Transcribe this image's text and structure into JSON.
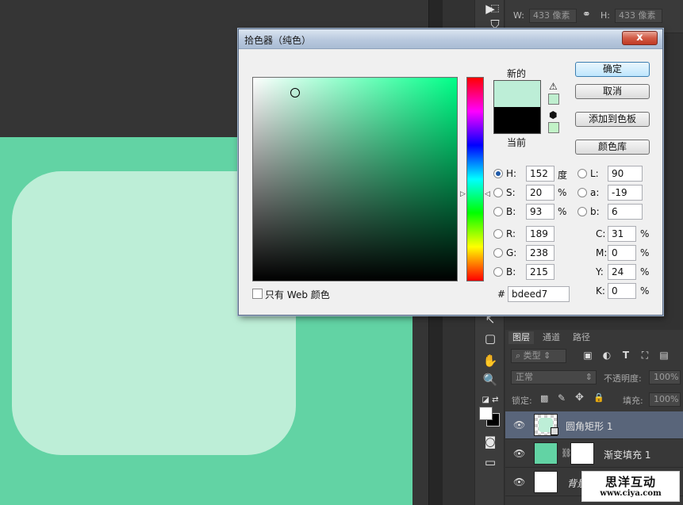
{
  "dialog": {
    "title": "拾色器（纯色）",
    "close_label": "x",
    "buttons": {
      "ok": "确定",
      "cancel": "取消",
      "add_swatch": "添加到色板",
      "libraries": "颜色库"
    },
    "new_label": "新的",
    "current_label": "当前",
    "web_only_label": "只有 Web 颜色",
    "hex_symbol": "#",
    "hex_value": "bdeed7",
    "colors": {
      "new": "#bdeed7",
      "current": "#000000",
      "hue_base": "#00ff88"
    },
    "hsb": {
      "h": {
        "label": "H:",
        "value": "152",
        "unit": "度"
      },
      "s": {
        "label": "S:",
        "value": "20",
        "unit": "%"
      },
      "b": {
        "label": "B:",
        "value": "93",
        "unit": "%"
      }
    },
    "lab": {
      "l": {
        "label": "L:",
        "value": "90"
      },
      "a": {
        "label": "a:",
        "value": "-19"
      },
      "b": {
        "label": "b:",
        "value": "6"
      }
    },
    "rgb": {
      "r": {
        "label": "R:",
        "value": "189"
      },
      "g": {
        "label": "G:",
        "value": "238"
      },
      "b": {
        "label": "B:",
        "value": "215"
      }
    },
    "cmyk": {
      "c": {
        "label": "C:",
        "value": "31",
        "unit": "%"
      },
      "m": {
        "label": "M:",
        "value": "0",
        "unit": "%"
      },
      "y": {
        "label": "Y:",
        "value": "24",
        "unit": "%"
      },
      "k": {
        "label": "K:",
        "value": "0",
        "unit": "%"
      }
    }
  },
  "properties": {
    "w_label": "W:",
    "w_value": "433 像素",
    "h_label": "H:",
    "h_value": "433 像素"
  },
  "layers_panel": {
    "tabs": [
      "图层",
      "通道",
      "路径"
    ],
    "filter_label": "类型",
    "blend_mode": "正常",
    "opacity_label": "不透明度:",
    "opacity_value": "100%",
    "lock_label": "锁定:",
    "fill_label": "填充:",
    "fill_value": "100%",
    "layers": [
      {
        "name": "圆角矩形 1"
      },
      {
        "name": "渐变填充 1"
      },
      {
        "name": "背景"
      }
    ]
  },
  "watermark": {
    "title": "思洋互动",
    "url": "www.ciya.com"
  }
}
